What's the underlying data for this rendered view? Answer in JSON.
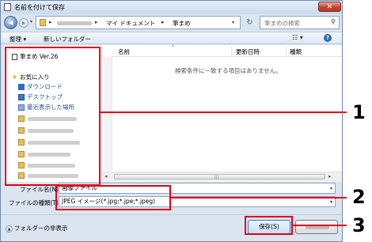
{
  "window": {
    "title": "名前を付けて保存",
    "close_glyph": "✕"
  },
  "navbar": {
    "back_glyph": "◀",
    "forward_glyph": "▶",
    "crumb_arrow": "▸",
    "crumb_docs": "マイ ドキュメント",
    "crumb_current": "筆まめ",
    "refresh_glyph": "↻",
    "search_placeholder": "筆まめの検索",
    "search_glyph": "⚲"
  },
  "toolbar": {
    "organize": "整理 ▾",
    "new_folder": "新しいフォルダー",
    "view_glyph": "☷ ▾",
    "help_glyph": "?"
  },
  "nav_pane": {
    "app_item": "筆まめ Ver.26",
    "favorites": "お気に入り",
    "downloads": "ダウンロード",
    "desktop": "デスクトップ",
    "recent": "最近表示した場所"
  },
  "content": {
    "col_name": "名前",
    "col_date": "更新日時",
    "col_type": "種類",
    "sort_glyph": "^",
    "empty_message": "検索条件に一致する項目はありません。"
  },
  "form": {
    "filename_label": "ファイル名(N):",
    "filename_value": "画像ファイル",
    "filetype_label": "ファイルの種類(T):",
    "filetype_value": "JPEG イメージ(*.jpg;*.jpe;*.jpeg)",
    "drop_glyph": "▾"
  },
  "footer": {
    "hide_folders": "フォルダーの非表示",
    "hide_glyph": "▲",
    "save_label": "保存(S)"
  },
  "callouts": [
    "1",
    "2",
    "3"
  ],
  "colors": {
    "highlight": "#e0001a",
    "window_frame": "#dbe5f0",
    "link": "#1f4ea0"
  }
}
